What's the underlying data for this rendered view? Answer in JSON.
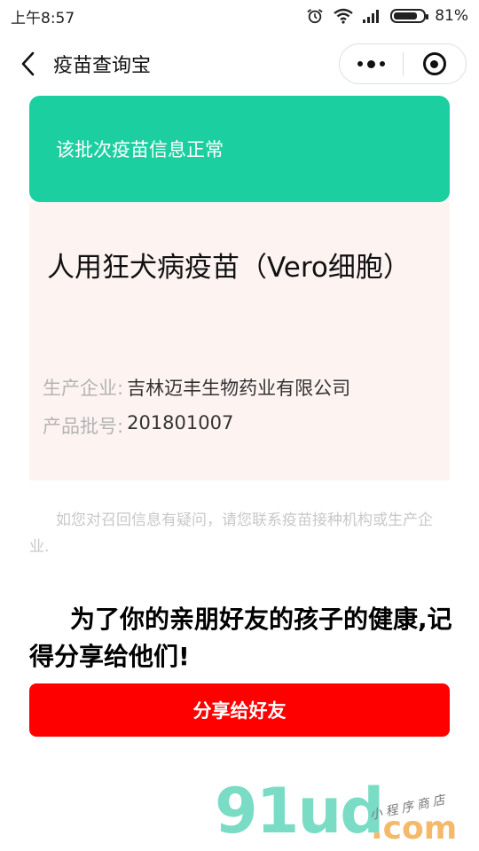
{
  "status_bar": {
    "time": "上午8:57",
    "battery_percent_text": "81%",
    "battery_level": 0.81,
    "icons": [
      "alarm-icon",
      "wifi-icon",
      "signal-icon",
      "battery-icon"
    ]
  },
  "navbar": {
    "title": "疫苗查询宝",
    "back_icon": "chevron-left-icon",
    "menu_icon": "more-dots-icon",
    "close_icon": "target-circle-icon"
  },
  "status_card": {
    "message": "该批次疫苗信息正常",
    "color": "#1ccfa0"
  },
  "vaccine": {
    "name": "人用狂犬病疫苗（Vero细胞）",
    "manufacturer_label": "生产企业:",
    "manufacturer": "吉林迈丰生物药业有限公司",
    "batch_label": "产品批号:",
    "batch": "201801007"
  },
  "notice": "如您对召回信息有疑问，请您联系疫苗接种机构或生产企业.",
  "promo": "为了你的亲朋好友的孩子的健康,记得分享给他们!",
  "share_button": {
    "label": "分享给好友",
    "color": "#ff0000"
  },
  "watermark": {
    "main": "91ud",
    "domain": ".com",
    "subtitle": "小程序商店"
  }
}
